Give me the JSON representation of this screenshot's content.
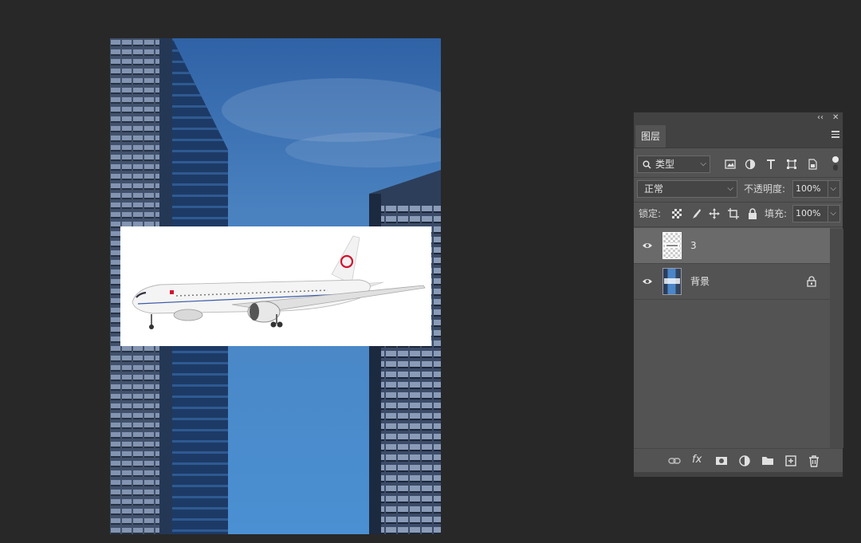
{
  "panel": {
    "collapse_glyph": "‹‹",
    "close_glyph": "✕",
    "tab_label": "图层",
    "filter": {
      "icon": "search-icon",
      "value": "类型"
    },
    "filter_icons": [
      "image-icon",
      "adjustment-circle-icon",
      "type-icon",
      "shape-transform-icon",
      "smart-object-icon"
    ],
    "blend_mode": "正常",
    "opacity_label": "不透明度:",
    "opacity_value": "100%",
    "lock_label": "锁定:",
    "lock_icons": [
      "lock-transparent-icon",
      "lock-paint-icon",
      "lock-position-icon",
      "lock-artboard-icon",
      "lock-all-icon"
    ],
    "fill_label": "填充:",
    "fill_value": "100%",
    "layers": [
      {
        "name": "3",
        "visible": true,
        "selected": true,
        "locked": false,
        "thumb": "checker-with-plane"
      },
      {
        "name": "背景",
        "visible": true,
        "selected": false,
        "locked": true,
        "thumb": "building-photo"
      }
    ],
    "footer_icons": [
      "link-layers-icon",
      "fx-icon",
      "add-mask-icon",
      "adjustment-layer-icon",
      "new-group-icon",
      "new-layer-icon",
      "delete-icon"
    ],
    "fx_label": "fx"
  },
  "colors": {
    "app_bg": "#282828",
    "panel_bg": "#535353",
    "panel_header": "#424242",
    "selected_layer": "#6a6a6a",
    "sky": "#3f78b8",
    "building": "#2e3d55"
  }
}
